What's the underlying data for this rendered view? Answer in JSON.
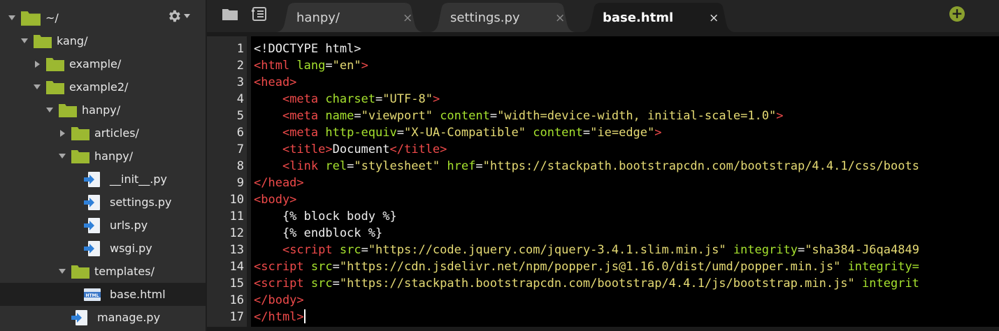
{
  "colors": {
    "folder": "#9cb831",
    "tag": "#ef4a4a",
    "attr": "#a6e22e",
    "string": "#e6db74",
    "text": "#f0f0f0",
    "add": "#8aa02e"
  },
  "sidebar": {
    "settings_icon": "gear-icon",
    "items": [
      {
        "label": "~/",
        "type": "folder",
        "depth": 0,
        "expanded": true
      },
      {
        "label": "kang/",
        "type": "folder",
        "depth": 1,
        "expanded": true
      },
      {
        "label": "example/",
        "type": "folder",
        "depth": 2,
        "expanded": false
      },
      {
        "label": "example2/",
        "type": "folder",
        "depth": 2,
        "expanded": true
      },
      {
        "label": "hanpy/",
        "type": "folder",
        "depth": 3,
        "expanded": true
      },
      {
        "label": "articles/",
        "type": "folder",
        "depth": 4,
        "expanded": false
      },
      {
        "label": "hanpy/",
        "type": "folder",
        "depth": 4,
        "expanded": true
      },
      {
        "label": "__init__.py",
        "type": "py",
        "depth": 5
      },
      {
        "label": "settings.py",
        "type": "py",
        "depth": 5
      },
      {
        "label": "urls.py",
        "type": "py",
        "depth": 5
      },
      {
        "label": "wsgi.py",
        "type": "py",
        "depth": 5
      },
      {
        "label": "templates/",
        "type": "folder",
        "depth": 4,
        "expanded": true
      },
      {
        "label": "base.html",
        "type": "html",
        "depth": 5,
        "selected": true
      },
      {
        "label": "manage.py",
        "type": "py",
        "depth": 4
      }
    ]
  },
  "tabs": [
    {
      "label": "hanpy/",
      "active": false
    },
    {
      "label": "settings.py",
      "active": false
    },
    {
      "label": "base.html",
      "active": true
    }
  ],
  "tab_close": "×",
  "add_tab": "+",
  "editor": {
    "lines": [
      [
        [
          "d",
          "<!DOCTYPE html>"
        ]
      ],
      [
        [
          "t",
          "<html "
        ],
        [
          "a",
          "lang"
        ],
        [
          "d",
          "="
        ],
        [
          "s",
          "\"en\""
        ],
        [
          "t",
          ">"
        ]
      ],
      [
        [
          "t",
          "<head>"
        ]
      ],
      [
        [
          "d",
          "    "
        ],
        [
          "t",
          "<meta "
        ],
        [
          "a",
          "charset"
        ],
        [
          "d",
          "="
        ],
        [
          "s",
          "\"UTF-8\""
        ],
        [
          "t",
          ">"
        ]
      ],
      [
        [
          "d",
          "    "
        ],
        [
          "t",
          "<meta "
        ],
        [
          "a",
          "name"
        ],
        [
          "d",
          "="
        ],
        [
          "s",
          "\"viewport\""
        ],
        [
          "d",
          " "
        ],
        [
          "a",
          "content"
        ],
        [
          "d",
          "="
        ],
        [
          "s",
          "\"width=device-width, initial-scale=1.0\""
        ],
        [
          "t",
          ">"
        ]
      ],
      [
        [
          "d",
          "    "
        ],
        [
          "t",
          "<meta "
        ],
        [
          "a",
          "http-equiv"
        ],
        [
          "d",
          "="
        ],
        [
          "s",
          "\"X-UA-Compatible\""
        ],
        [
          "d",
          " "
        ],
        [
          "a",
          "content"
        ],
        [
          "d",
          "="
        ],
        [
          "s",
          "\"ie=edge\""
        ],
        [
          "t",
          ">"
        ]
      ],
      [
        [
          "d",
          "    "
        ],
        [
          "t",
          "<title>"
        ],
        [
          "d",
          "Document"
        ],
        [
          "t",
          "</title>"
        ]
      ],
      [
        [
          "d",
          "    "
        ],
        [
          "t",
          "<link "
        ],
        [
          "a",
          "rel"
        ],
        [
          "d",
          "="
        ],
        [
          "s",
          "\"stylesheet\""
        ],
        [
          "d",
          " "
        ],
        [
          "a",
          "href"
        ],
        [
          "d",
          "="
        ],
        [
          "s",
          "\"https://stackpath.bootstrapcdn.com/bootstrap/4.4.1/css/boots"
        ]
      ],
      [
        [
          "t",
          "</head>"
        ]
      ],
      [
        [
          "t",
          "<body>"
        ]
      ],
      [
        [
          "d",
          "    {% block body %}"
        ]
      ],
      [
        [
          "d",
          "    {% endblock %}"
        ]
      ],
      [
        [
          "d",
          "    "
        ],
        [
          "t",
          "<script "
        ],
        [
          "a",
          "src"
        ],
        [
          "d",
          "="
        ],
        [
          "s",
          "\"https://code.jquery.com/jquery-3.4.1.slim.min.js\""
        ],
        [
          "d",
          " "
        ],
        [
          "a",
          "integrity"
        ],
        [
          "d",
          "="
        ],
        [
          "s",
          "\"sha384-J6qa4849"
        ]
      ],
      [
        [
          "t",
          "<script "
        ],
        [
          "a",
          "src"
        ],
        [
          "d",
          "="
        ],
        [
          "s",
          "\"https://cdn.jsdelivr.net/npm/popper.js@1.16.0/dist/umd/popper.min.js\""
        ],
        [
          "d",
          " "
        ],
        [
          "a",
          "integrity="
        ]
      ],
      [
        [
          "t",
          "<script "
        ],
        [
          "a",
          "src"
        ],
        [
          "d",
          "="
        ],
        [
          "s",
          "\"https://stackpath.bootstrapcdn.com/bootstrap/4.4.1/js/bootstrap.min.js\""
        ],
        [
          "d",
          " "
        ],
        [
          "a",
          "integrit"
        ]
      ],
      [
        [
          "t",
          "</body>"
        ]
      ],
      [
        [
          "t",
          "</html>"
        ]
      ]
    ]
  }
}
